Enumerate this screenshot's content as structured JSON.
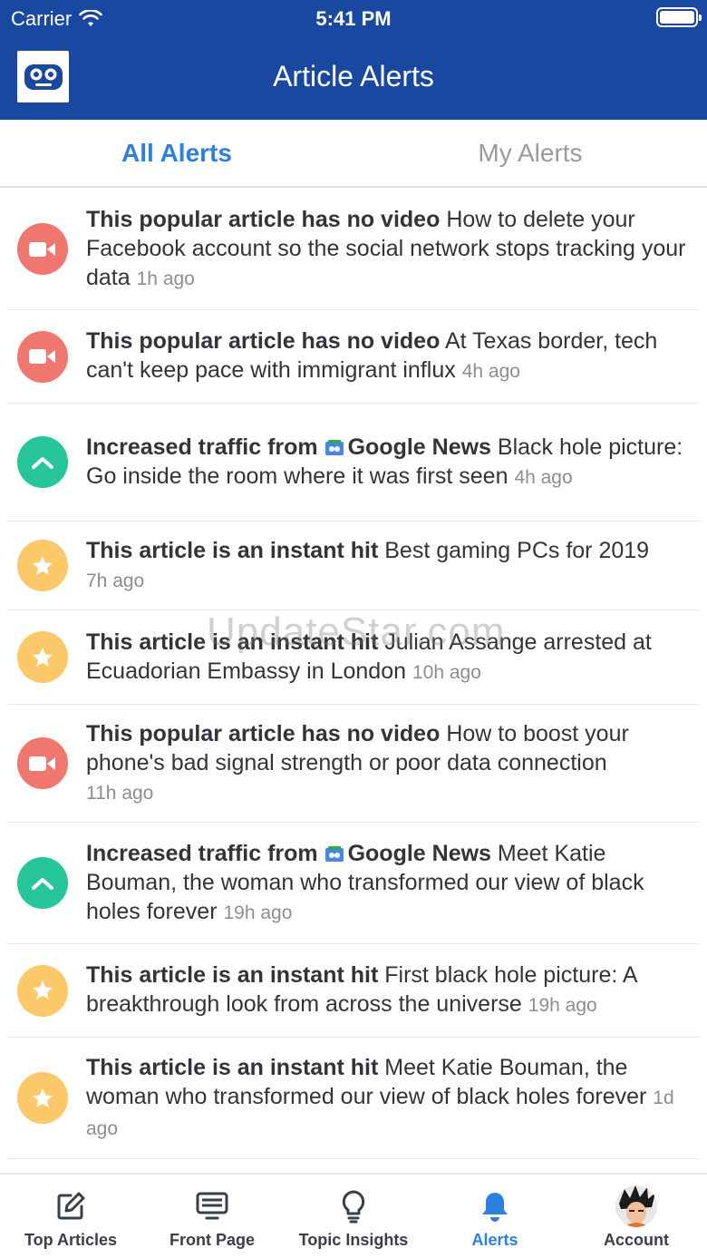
{
  "status_bar": {
    "carrier": "Carrier",
    "time": "5:41 PM"
  },
  "header": {
    "title": "Article Alerts",
    "logo_icon": "robot-eyes-logo-icon"
  },
  "tabs": [
    {
      "label": "All Alerts",
      "active": true
    },
    {
      "label": "My Alerts",
      "active": false
    }
  ],
  "alerts": [
    {
      "type": "video",
      "icon": "video-camera-icon",
      "lead": "This popular article has no video",
      "source": "",
      "title": "How to delete your Facebook account so the social network stops tracking your data",
      "time": "1h ago"
    },
    {
      "type": "video",
      "icon": "video-camera-icon",
      "lead": "This popular article has no video",
      "source": "",
      "title": "At Texas border, tech can't keep pace with immigrant influx",
      "time": "4h ago"
    },
    {
      "type": "traffic",
      "icon": "chevron-up-icon",
      "lead": "Increased traffic from",
      "source": "Google News",
      "title": "Black hole picture: Go inside the room where it was first seen",
      "time": "4h ago"
    },
    {
      "type": "hit",
      "icon": "star-icon",
      "lead": "This article is an instant hit",
      "source": "",
      "title": "Best gaming PCs for 2019",
      "time": "7h ago"
    },
    {
      "type": "hit",
      "icon": "star-icon",
      "lead": "This article is an instant hit",
      "source": "",
      "title": "Julian Assange arrested at Ecuadorian Embassy in London",
      "time": "10h ago"
    },
    {
      "type": "video",
      "icon": "video-camera-icon",
      "lead": "This popular article has no video",
      "source": "",
      "title": "How to boost your phone's bad signal strength or poor data connection",
      "time": "11h ago"
    },
    {
      "type": "traffic",
      "icon": "chevron-up-icon",
      "lead": "Increased traffic from",
      "source": "Google News",
      "title": "Meet Katie Bouman, the woman who transformed our view of black holes forever",
      "time": "19h ago"
    },
    {
      "type": "hit",
      "icon": "star-icon",
      "lead": "This article is an instant hit",
      "source": "",
      "title": "First black hole picture: A breakthrough look from across the universe",
      "time": "19h ago"
    },
    {
      "type": "hit",
      "icon": "star-icon",
      "lead": "This article is an instant hit",
      "source": "",
      "title": "Meet Katie Bouman, the woman who transformed our view of black holes forever",
      "time": "1d ago"
    }
  ],
  "tabbar": [
    {
      "label": "Top Articles",
      "icon": "edit-icon",
      "active": false
    },
    {
      "label": "Front Page",
      "icon": "monitor-icon",
      "active": false
    },
    {
      "label": "Topic Insights",
      "icon": "lightbulb-icon",
      "active": false
    },
    {
      "label": "Alerts",
      "icon": "bell-icon",
      "active": true
    },
    {
      "label": "Account",
      "icon": "avatar-icon",
      "active": false
    }
  ],
  "watermark": "UpdateStar.com",
  "colors": {
    "header": "#1848a0",
    "accent": "#2d7fe0",
    "video": "#ef776f",
    "traffic": "#27c59a",
    "hit": "#fcc96a"
  }
}
